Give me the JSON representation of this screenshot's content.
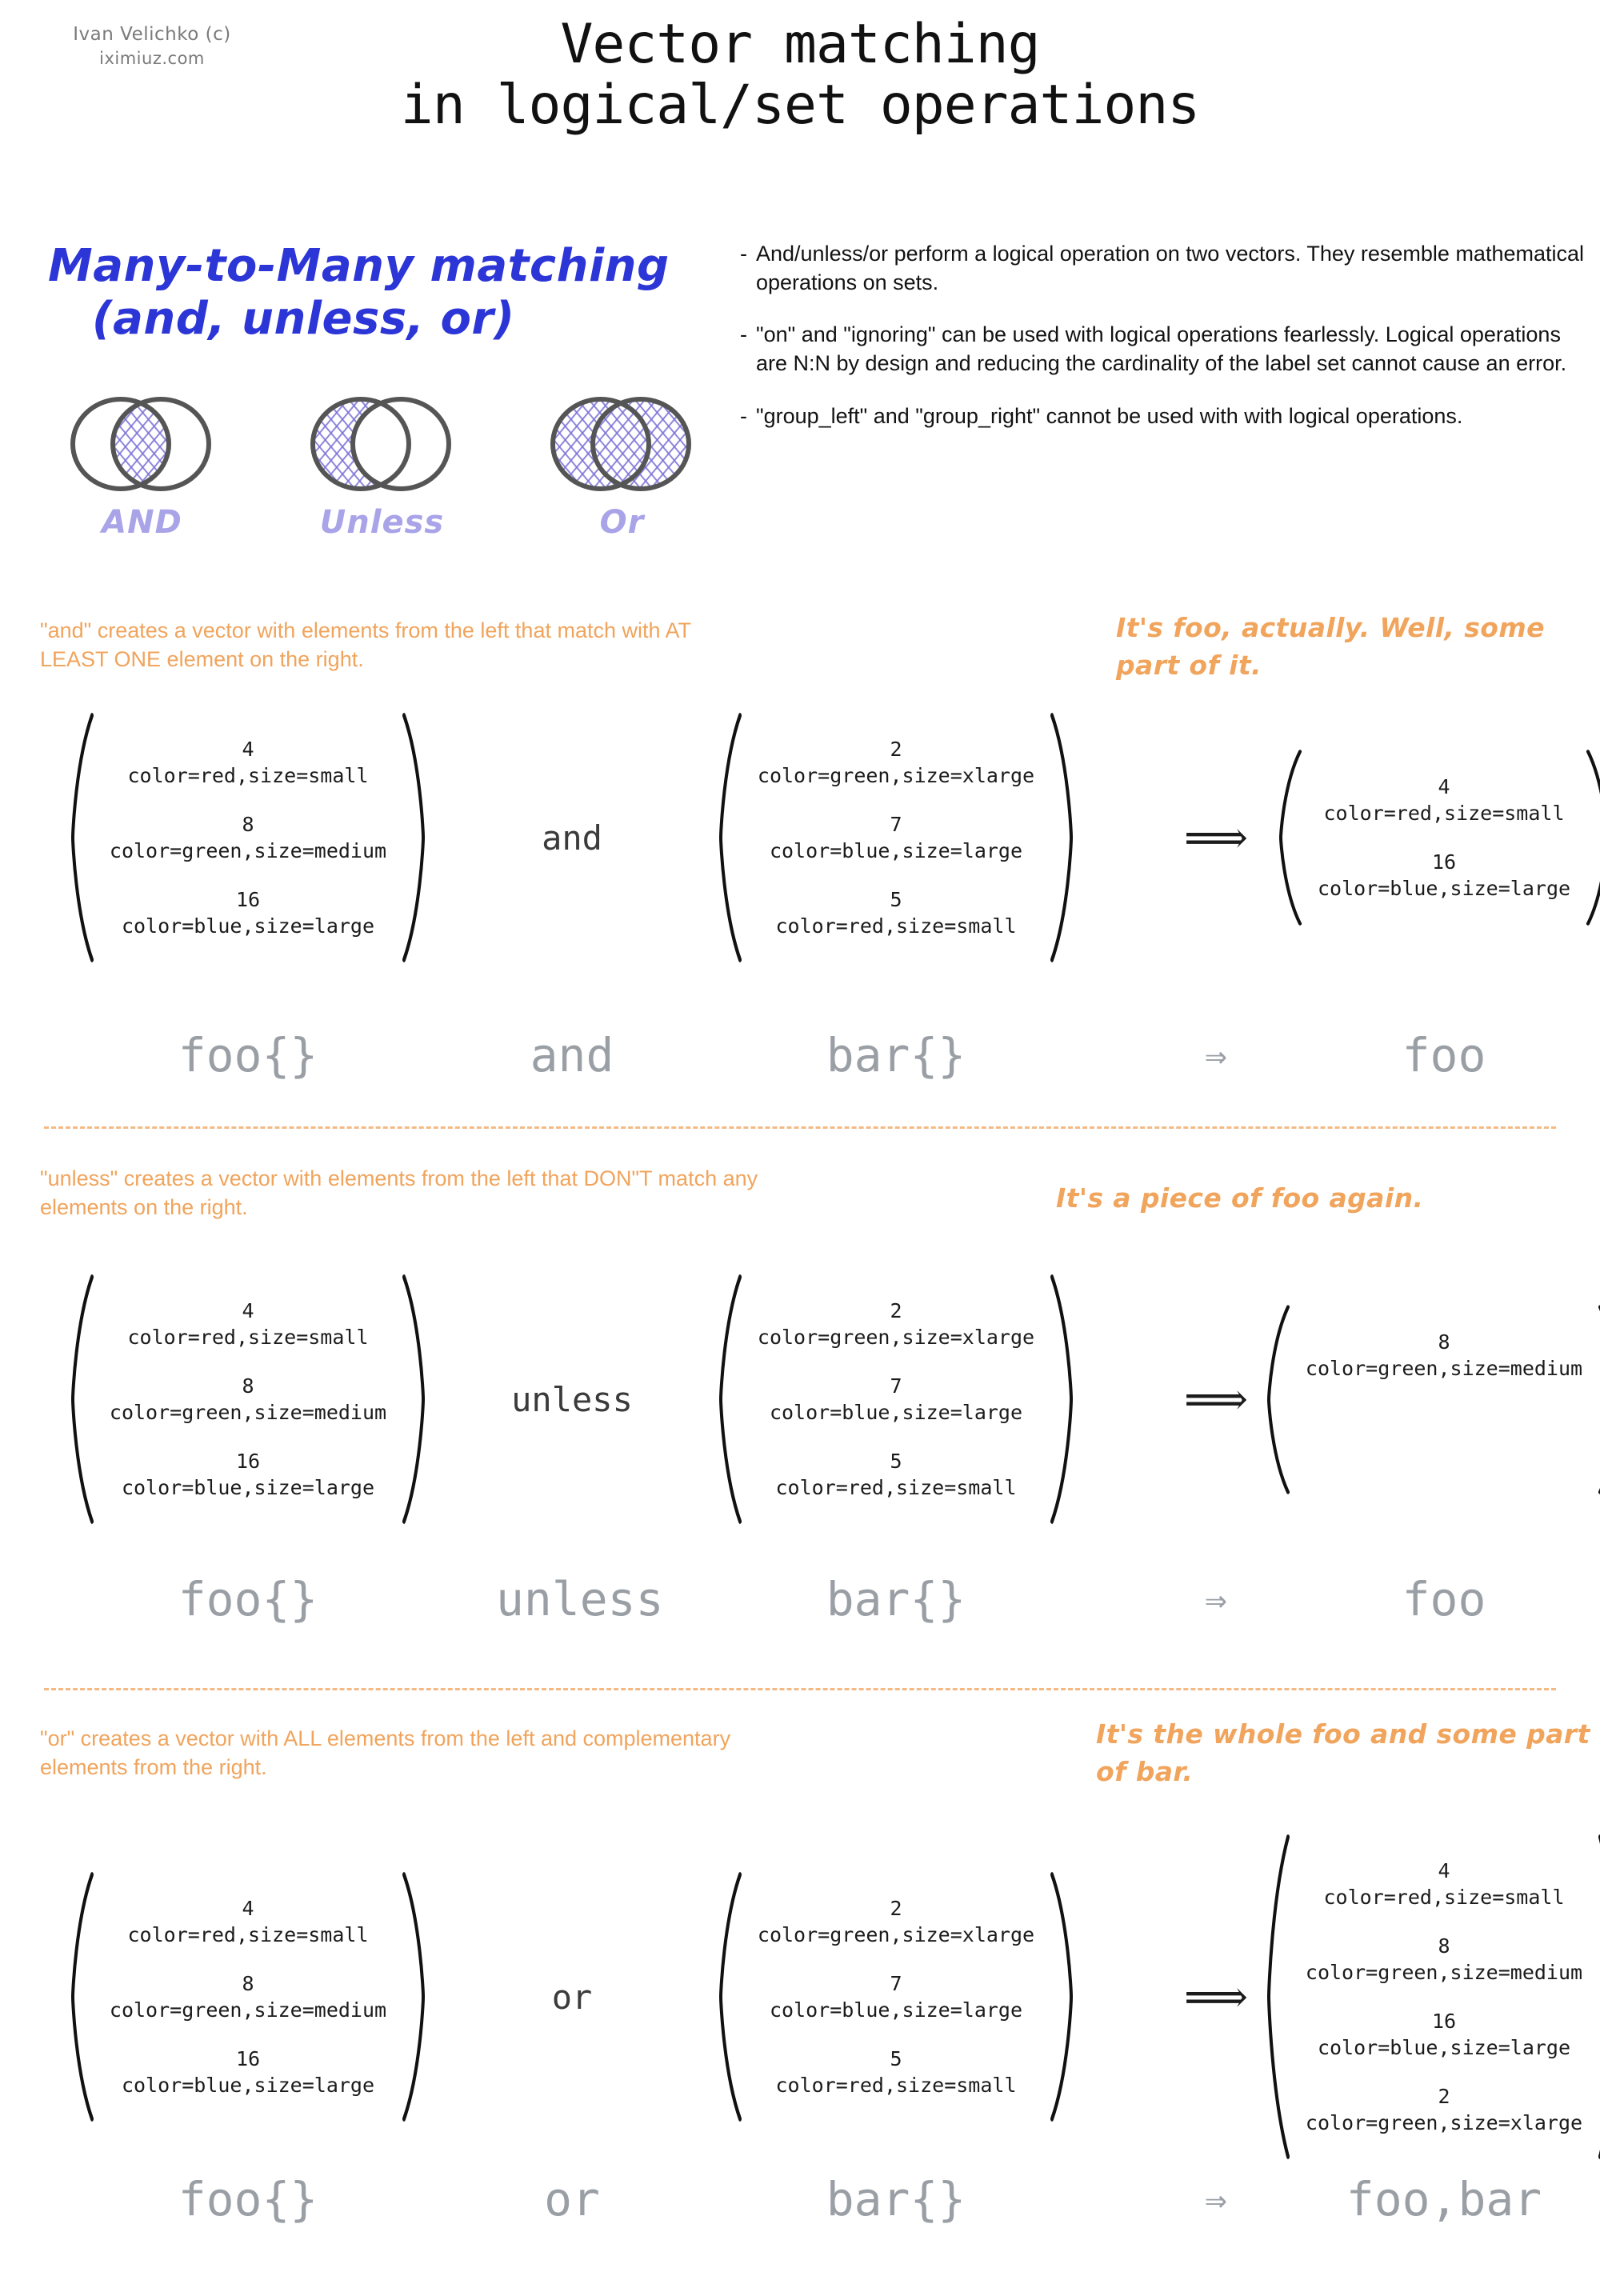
{
  "attribution": {
    "line1": "Ivan Velichko (c)",
    "line2": "iximiuz.com"
  },
  "title": {
    "line1": "Vector matching",
    "line2": "in logical/set operations"
  },
  "m2m": {
    "heading_line1": "Many-to-Many matching",
    "heading_line2": "(and, unless, or)",
    "venn": [
      {
        "label": "AND",
        "fill": "intersection"
      },
      {
        "label": "Unless",
        "fill": "left-only"
      },
      {
        "label": "Or",
        "fill": "union"
      }
    ]
  },
  "notes": [
    "And/unless/or perform a logical operation on two vectors. They resemble mathematical operations on sets.",
    "\"on\" and \"ignoring\" can be used with logical operations fearlessly. Logical operations are N:N by design and reducing the cardinality of the label set cannot cause an error.",
    "\"group_left\" and \"group_right\" cannot be used with with logical operations."
  ],
  "colors": {
    "accent_orange": "#f0a45c",
    "heading_blue": "#2c35d6",
    "venn_purple": "#7b72d6",
    "venn_label_purple": "#a9a3e8",
    "expr_gray": "#9a9fa5",
    "highlight_red": "#f7e3e4",
    "highlight_blue": "#e6e6f6",
    "highlight_green": "#e9f0e3"
  },
  "sections": [
    {
      "id": "and",
      "description": "\"and\" creates a vector with elements from the left that match with AT LEAST ONE element on the right.",
      "quip": "It's foo, actually. Well, some part of it.",
      "operator": "and",
      "arrow": "⟹",
      "left": [
        {
          "num": "4",
          "labels": "color=red,size=small",
          "highlight": "red"
        },
        {
          "num": "8",
          "labels": "color=green,size=medium",
          "highlight": "none"
        },
        {
          "num": "16",
          "labels": "color=blue,size=large",
          "highlight": "blue"
        }
      ],
      "right": [
        {
          "num": "2",
          "labels": "color=green,size=xlarge",
          "highlight": "none"
        },
        {
          "num": "7",
          "labels": "color=blue,size=large",
          "highlight": "blue"
        },
        {
          "num": "5",
          "labels": "color=red,size=small",
          "highlight": "red"
        }
      ],
      "result": [
        {
          "num": "4",
          "labels": "color=red,size=small",
          "highlight": "red"
        },
        {
          "num": "16",
          "labels": "color=blue,size=large",
          "highlight": "blue"
        }
      ],
      "expr": {
        "left": "foo{}",
        "operator": "and",
        "right": "bar{}",
        "arrow": "⇒",
        "result": "foo"
      }
    },
    {
      "id": "unless",
      "description": "\"unless\" creates a vector with elements from the left that DON\"T match any elements on the right.",
      "quip": "It's a piece of foo again.",
      "operator": "unless",
      "arrow": "⟹",
      "left": [
        {
          "num": "4",
          "labels": "color=red,size=small",
          "highlight": "none"
        },
        {
          "num": "8",
          "labels": "color=green,size=medium",
          "highlight": "green"
        },
        {
          "num": "16",
          "labels": "color=blue,size=large",
          "highlight": "none"
        }
      ],
      "right": [
        {
          "num": "2",
          "labels": "color=green,size=xlarge",
          "highlight": "none"
        },
        {
          "num": "7",
          "labels": "color=blue,size=large",
          "highlight": "none"
        },
        {
          "num": "5",
          "labels": "color=red,size=small",
          "highlight": "none"
        }
      ],
      "result": [
        {
          "num": "8",
          "labels": "color=green,size=medium",
          "highlight": "green"
        }
      ],
      "expr": {
        "left": "foo{}",
        "operator": "unless",
        "right": "bar{}",
        "arrow": "⇒",
        "result": "foo"
      }
    },
    {
      "id": "or",
      "description": "\"or\" creates a vector with ALL elements from the left and complementary elements from the right.",
      "quip": "It's the whole foo and some part of bar.",
      "operator": "or",
      "arrow": "⟹",
      "left": [
        {
          "num": "4",
          "labels": "color=red,size=small",
          "highlight": "red"
        },
        {
          "num": "8",
          "labels": "color=green,size=medium",
          "highlight": "green"
        },
        {
          "num": "16",
          "labels": "color=blue,size=large",
          "highlight": "blue"
        }
      ],
      "right": [
        {
          "num": "2",
          "labels": "color=green,size=xlarge",
          "highlight": "green"
        },
        {
          "num": "7",
          "labels": "color=blue,size=large",
          "highlight": "blue"
        },
        {
          "num": "5",
          "labels": "color=red,size=small",
          "highlight": "red"
        }
      ],
      "result": [
        {
          "num": "4",
          "labels": "color=red,size=small",
          "highlight": "red"
        },
        {
          "num": "8",
          "labels": "color=green,size=medium",
          "highlight": "green"
        },
        {
          "num": "16",
          "labels": "color=blue,size=large",
          "highlight": "blue"
        },
        {
          "num": "2",
          "labels": "color=green,size=xlarge",
          "highlight": "green"
        }
      ],
      "expr": {
        "left": "foo{}",
        "operator": "or",
        "right": "bar{}",
        "arrow": "⇒",
        "result": "foo,bar"
      }
    }
  ]
}
